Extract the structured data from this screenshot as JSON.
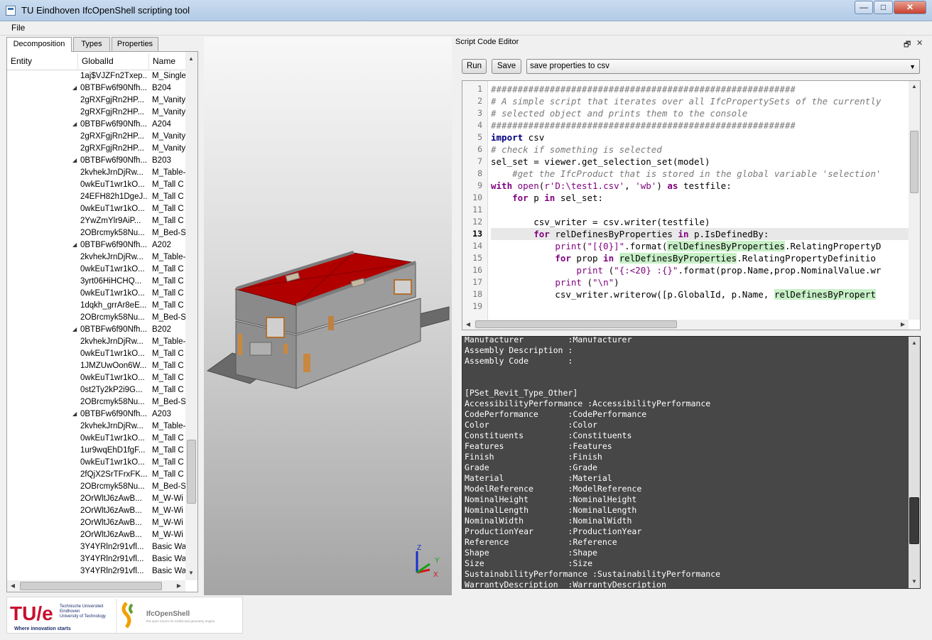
{
  "window": {
    "title": "TU Eindhoven IfcOpenShell scripting tool",
    "controls": {
      "minimize": "—",
      "maximize": "□",
      "close": "✕"
    }
  },
  "menu": {
    "file": "File"
  },
  "tabs": [
    "Decomposition",
    "Types",
    "Properties"
  ],
  "tree": {
    "columns": [
      "Entity",
      "GlobalId",
      "Name"
    ],
    "rows": [
      {
        "gid": "1aj$VJZFn2Txep...",
        "name": "M_Single",
        "expand": false
      },
      {
        "gid": "0BTBFw6f90Nfh...",
        "name": "B204",
        "expand": true
      },
      {
        "gid": "2gRXFgjRn2HP...",
        "name": "M_Vanity",
        "expand": false
      },
      {
        "gid": "2gRXFgjRn2HP...",
        "name": "M_Vanity",
        "expand": false
      },
      {
        "gid": "0BTBFw6f90Nfh...",
        "name": "A204",
        "expand": true
      },
      {
        "gid": "2gRXFgjRn2HP...",
        "name": "M_Vanity",
        "expand": false
      },
      {
        "gid": "2gRXFgjRn2HP...",
        "name": "M_Vanity",
        "expand": false
      },
      {
        "gid": "0BTBFw6f90Nfh...",
        "name": "B203",
        "expand": true
      },
      {
        "gid": "2kvhekJrnDjRw...",
        "name": "M_Table-",
        "expand": false
      },
      {
        "gid": "0wkEuT1wr1kO...",
        "name": "M_Tall C",
        "expand": false
      },
      {
        "gid": "24EFH82h1DgeJ...",
        "name": "M_Tall C",
        "expand": false
      },
      {
        "gid": "0wkEuT1wr1kO...",
        "name": "M_Tall C",
        "expand": false
      },
      {
        "gid": "2YwZmYlr9AiP...",
        "name": "M_Tall C",
        "expand": false
      },
      {
        "gid": "2OBrcmyk58Nu...",
        "name": "M_Bed-S",
        "expand": false
      },
      {
        "gid": "0BTBFw6f90Nfh...",
        "name": "A202",
        "expand": true
      },
      {
        "gid": "2kvhekJrnDjRw...",
        "name": "M_Table-",
        "expand": false
      },
      {
        "gid": "0wkEuT1wr1kO...",
        "name": "M_Tall C",
        "expand": false
      },
      {
        "gid": "3yrt06HiHCHQ...",
        "name": "M_Tall C",
        "expand": false
      },
      {
        "gid": "0wkEuT1wr1kO...",
        "name": "M_Tall C",
        "expand": false
      },
      {
        "gid": "1dqkh_grrAr8eE...",
        "name": "M_Tall C",
        "expand": false
      },
      {
        "gid": "2OBrcmyk58Nu...",
        "name": "M_Bed-S",
        "expand": false
      },
      {
        "gid": "0BTBFw6f90Nfh...",
        "name": "B202",
        "expand": true
      },
      {
        "gid": "2kvhekJrnDjRw...",
        "name": "M_Table-",
        "expand": false
      },
      {
        "gid": "0wkEuT1wr1kO...",
        "name": "M_Tall C",
        "expand": false
      },
      {
        "gid": "1JMZUwOon6W...",
        "name": "M_Tall C",
        "expand": false
      },
      {
        "gid": "0wkEuT1wr1kO...",
        "name": "M_Tall C",
        "expand": false
      },
      {
        "gid": "0st2Ty2kP2i9G...",
        "name": "M_Tall C",
        "expand": false
      },
      {
        "gid": "2OBrcmyk58Nu...",
        "name": "M_Bed-S",
        "expand": false
      },
      {
        "gid": "0BTBFw6f90Nfh...",
        "name": "A203",
        "expand": true
      },
      {
        "gid": "2kvhekJrnDjRw...",
        "name": "M_Table-",
        "expand": false
      },
      {
        "gid": "0wkEuT1wr1kO...",
        "name": "M_Tall C",
        "expand": false
      },
      {
        "gid": "1ur9wqEhD1fgF...",
        "name": "M_Tall C",
        "expand": false
      },
      {
        "gid": "0wkEuT1wr1kO...",
        "name": "M_Tall C",
        "expand": false
      },
      {
        "gid": "2fQjX2SrTFrxFK...",
        "name": "M_Tall C",
        "expand": false
      },
      {
        "gid": "2OBrcmyk58Nu...",
        "name": "M_Bed-S",
        "expand": false
      },
      {
        "gid": "2OrWltJ6zAwB...",
        "name": "M_W-Wi",
        "expand": false
      },
      {
        "gid": "2OrWltJ6zAwB...",
        "name": "M_W-Wi",
        "expand": false
      },
      {
        "gid": "2OrWltJ6zAwB...",
        "name": "M_W-Wi",
        "expand": false
      },
      {
        "gid": "2OrWltJ6zAwB...",
        "name": "M_W-Wi",
        "expand": false
      },
      {
        "gid": "3Y4YRln2r91vfl...",
        "name": "Basic Wa",
        "expand": false
      },
      {
        "gid": "3Y4YRln2r91vfl...",
        "name": "Basic Wa",
        "expand": false
      },
      {
        "gid": "3Y4YRln2r91vfl...",
        "name": "Basic Wa",
        "expand": false
      }
    ]
  },
  "viewport": {
    "axis_labels": {
      "z": "Z",
      "y": "Y",
      "x": "X"
    }
  },
  "editor": {
    "dock_title": "Script Code Editor",
    "dock_restore": "🗗",
    "dock_close": "✕",
    "run_label": "Run",
    "save_label": "Save",
    "script_selected": "save properties to csv",
    "line_numbers": [
      "1",
      "2",
      "3",
      "4",
      "5",
      "6",
      "7",
      "8",
      "9",
      "10",
      "11",
      "12",
      "13",
      "14",
      "15",
      "16",
      "17",
      "18",
      "19"
    ],
    "current_line": "13",
    "code": {
      "l1": "#########################################################",
      "l2": "# A simple script that iterates over all IfcPropertySets of the currently",
      "l3": "# selected object and prints them to the console",
      "l4": "#########################################################",
      "l5a": "import",
      "l5b": " csv",
      "l6": "# check if something is selected",
      "l7": "sel_set = viewer.get_selection_set(model)",
      "l8": "    #get the IfcProduct that is stored in the global variable 'selection'",
      "l9a": "with",
      "l9b": " open",
      "l9c": "(",
      "l9d": "r'D:\\test1.csv'",
      "l9e": ", ",
      "l9f": "'wb'",
      "l9g": ") ",
      "l9h": "as",
      "l9i": " testfile:",
      "l10a": "    ",
      "l10b": "for",
      "l10c": " p ",
      "l10d": "in",
      "l10e": " sel_set:",
      "l12": "        csv_writer = csv.writer(testfile)",
      "l13a": "        ",
      "l13b": "for",
      "l13c": " relDefinesByProperties ",
      "l13d": "in",
      "l13e": " p.IsDefinedBy:",
      "l14a": "            ",
      "l14b": "print",
      "l14c": "(",
      "l14d": "\"[{0}]\"",
      "l14e": ".format(",
      "l14f": "relDefinesByProperties",
      "l14g": ".RelatingPropertyD",
      "l15a": "            ",
      "l15b": "for",
      "l15c": " prop ",
      "l15d": "in",
      "l15e": " ",
      "l15f": "relDefinesByProperties",
      "l15g": ".RelatingPropertyDefinitio",
      "l16a": "                ",
      "l16b": "print",
      "l16c": " (",
      "l16d": "\"{:<20} :{}\"",
      "l16e": ".format(prop.Name,prop.NominalValue.wr",
      "l17a": "            ",
      "l17b": "print",
      "l17c": " (",
      "l17d": "\"\\n\"",
      "l17e": ")",
      "l18a": "            csv_writer.writerow([p.GlobalId, p.Name, ",
      "l18b": "relDefinesByPropert"
    }
  },
  "console": {
    "lines": [
      "Manufacturer         :Manufacturer",
      "Assembly Description :",
      "Assembly Code        :",
      "",
      "",
      "[PSet_Revit_Type_Other]",
      "AccessibilityPerformance :AccessibilityPerformance",
      "CodePerformance      :CodePerformance",
      "Color                :Color",
      "Constituents         :Constituents",
      "Features             :Features",
      "Finish               :Finish",
      "Grade                :Grade",
      "Material             :Material",
      "ModelReference       :ModelReference",
      "NominalHeight        :NominalHeight",
      "NominalLength        :NominalLength",
      "NominalWidth         :NominalWidth",
      "ProductionYear       :ProductionYear",
      "Reference            :Reference",
      "Shape                :Shape",
      "Size                 :Size",
      "SustainabilityPerformance :SustainabilityPerformance",
      "WarrantyDescription  :WarrantyDescription"
    ]
  },
  "logos": {
    "tue_mark": "TU/e",
    "tue_name1": "Technische Universiteit",
    "tue_name2": "Eindhoven",
    "tue_name3": "University of Technology",
    "tue_slogan": "Where innovation starts",
    "ifc_name": "IfcOpenShell",
    "ifc_tagline": "the open source ifc toolkit and geometry engine"
  },
  "colors": {
    "roof": "#b00000",
    "console_bg": "#474747",
    "tue_red": "#c8102e",
    "tue_blue": "#1c2e6e"
  }
}
